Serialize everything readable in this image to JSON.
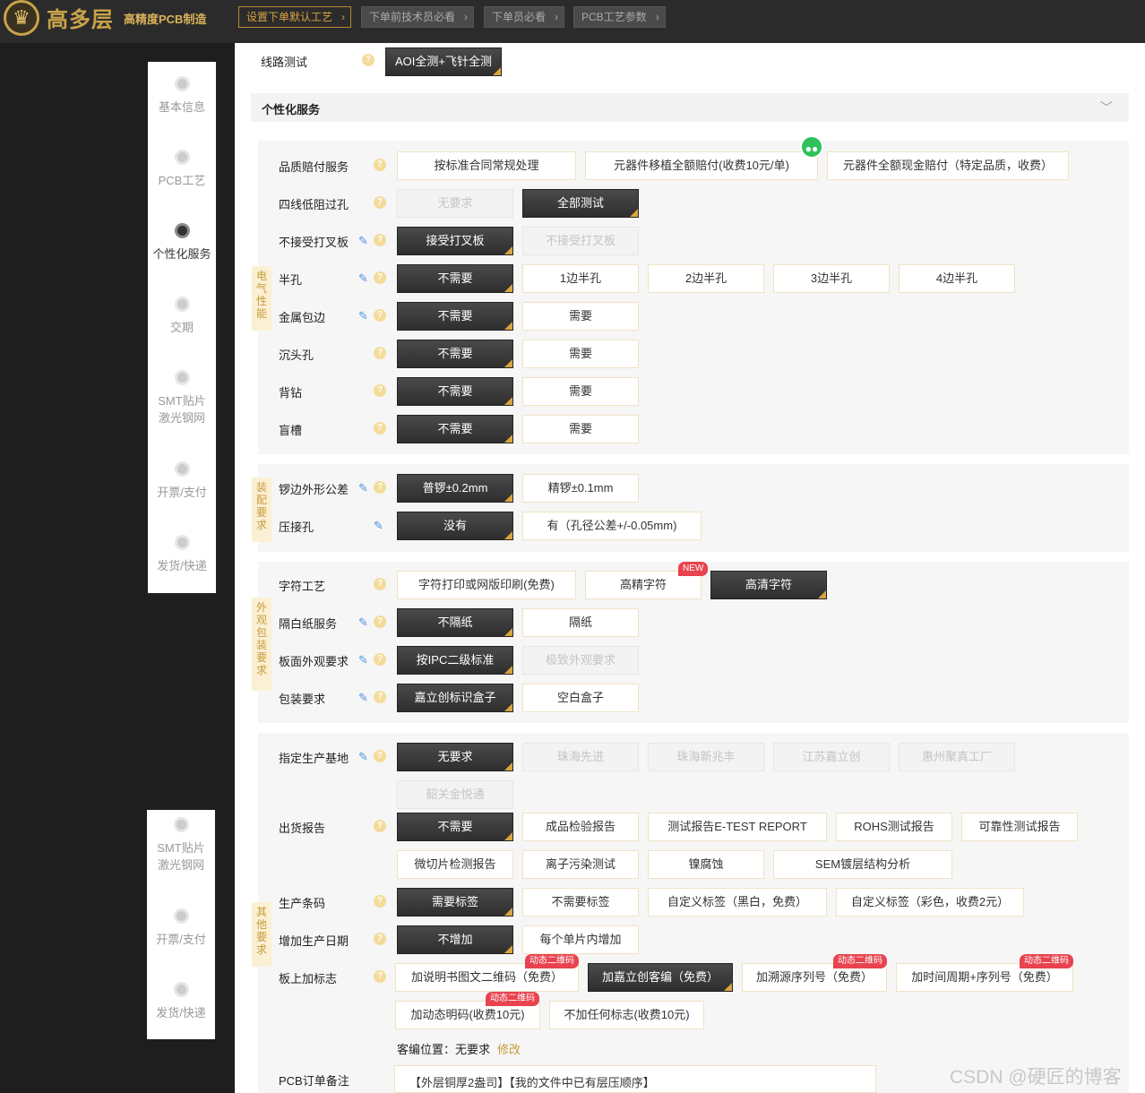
{
  "brand": {
    "name": "高多层",
    "tagline": "高精度PCB制造",
    "logo_icon": "crown-icon"
  },
  "nav": [
    {
      "label": "设置下单默认工艺",
      "active": true
    },
    {
      "label": "下单前技术员必看",
      "active": false
    },
    {
      "label": "下单员必看",
      "active": false
    },
    {
      "label": "PCB工艺参数",
      "active": false
    }
  ],
  "steps_top": [
    {
      "label": "基本信息"
    },
    {
      "label": "PCB工艺"
    },
    {
      "label": "个性化服务",
      "active": true
    },
    {
      "label": "交期"
    },
    {
      "label": "SMT贴片",
      "label2": "激光钢网"
    },
    {
      "label": "开票/支付"
    },
    {
      "label": "发货/快递"
    }
  ],
  "steps_bottom": [
    {
      "label": "SMT贴片",
      "label2": "激光钢网"
    },
    {
      "label": "开票/支付"
    },
    {
      "label": "发货/快递"
    }
  ],
  "line_test": {
    "label": "线路测试",
    "value": "AOI全测+飞针全测"
  },
  "service_section": {
    "title": "个性化服务",
    "chevron": "chevron-down-icon"
  },
  "group_labels": {
    "electrical": "电气性能",
    "assembly": "装配要求",
    "appearance": "外观包装要求",
    "other": "其他要求"
  },
  "rows": {
    "quality": {
      "label": "品质赔付服务",
      "options": [
        "按标准合同常规处理",
        "元器件移植全额赔付(收费10元/单)",
        "元器件全额现金赔付（特定品质，收费）"
      ]
    },
    "four_wire": {
      "label": "四线低阻过孔",
      "options": [
        "无要求",
        "全部测试"
      ]
    },
    "xout": {
      "label": "不接受打叉板",
      "options": [
        "接受打叉板",
        "不接受打叉板"
      ]
    },
    "half_hole": {
      "label": "半孔",
      "options": [
        "不需要",
        "1边半孔",
        "2边半孔",
        "3边半孔",
        "4边半孔"
      ]
    },
    "metal_edge": {
      "label": "金属包边",
      "options": [
        "不需要",
        "需要"
      ]
    },
    "countersink": {
      "label": "沉头孔",
      "options": [
        "不需要",
        "需要"
      ]
    },
    "back_drill": {
      "label": "背钻",
      "options": [
        "不需要",
        "需要"
      ]
    },
    "blind_slot": {
      "label": "盲槽",
      "options": [
        "不需要",
        "需要"
      ]
    },
    "routing_tol": {
      "label": "锣边外形公差",
      "options": [
        "普锣±0.2mm",
        "精锣±0.1mm"
      ]
    },
    "press_fit": {
      "label": "压接孔",
      "options": [
        "没有",
        "有（孔径公差+/-0.05mm)"
      ]
    },
    "legend": {
      "label": "字符工艺",
      "options": [
        "字符打印或网版印刷(免费)",
        "高精字符",
        "高清字符"
      ],
      "badge": "NEW"
    },
    "separator": {
      "label": "隔白纸服务",
      "options": [
        "不隔纸",
        "隔纸"
      ]
    },
    "surface": {
      "label": "板面外观要求",
      "options": [
        "按IPC二级标准",
        "极致外观要求"
      ]
    },
    "packing": {
      "label": "包装要求",
      "options": [
        "嘉立创标识盒子",
        "空白盒子"
      ]
    },
    "factory": {
      "label": "指定生产基地",
      "options": [
        "无要求",
        "珠海先进",
        "珠海新兆丰",
        "江苏嘉立创",
        "惠州聚真工厂",
        "韶关金悦通"
      ]
    },
    "report": {
      "label": "出货报告",
      "options": [
        "不需要",
        "成品检验报告",
        "测试报告E-TEST REPORT",
        "ROHS测试报告",
        "可靠性测试报告",
        "微切片检测报告",
        "离子污染测试",
        "镍腐蚀",
        "SEM镀层结构分析"
      ]
    },
    "barcode": {
      "label": "生产条码",
      "options": [
        "需要标签",
        "不需要标签",
        "自定义标签（黑白，免费）",
        "自定义标签（彩色，收费2元）"
      ]
    },
    "date": {
      "label": "增加生产日期",
      "options": [
        "不增加",
        "每个单片内增加"
      ]
    },
    "marking": {
      "label": "板上加标志",
      "options": [
        "加说明书图文二维码（免费）",
        "加嘉立创客编（免费）",
        "加溯源序列号（免费）",
        "加时间周期+序列号（免费）",
        "加动态明码(收费10元)",
        "不加任何标志(收费10元)"
      ],
      "badge": "动态二维码"
    }
  },
  "customer_code": {
    "label": "客编位置：",
    "value": "无要求",
    "link": "修改"
  },
  "remark": {
    "label": "PCB订单备注",
    "value": "【外层铜厚2盎司】【我的文件中已有层压顺序】"
  },
  "watermark": "CSDN @硬匠的博客",
  "colors": {
    "selected": "#333333",
    "accent": "#d9a441",
    "border": "#f0e3c4",
    "badge": "#e8434f"
  }
}
